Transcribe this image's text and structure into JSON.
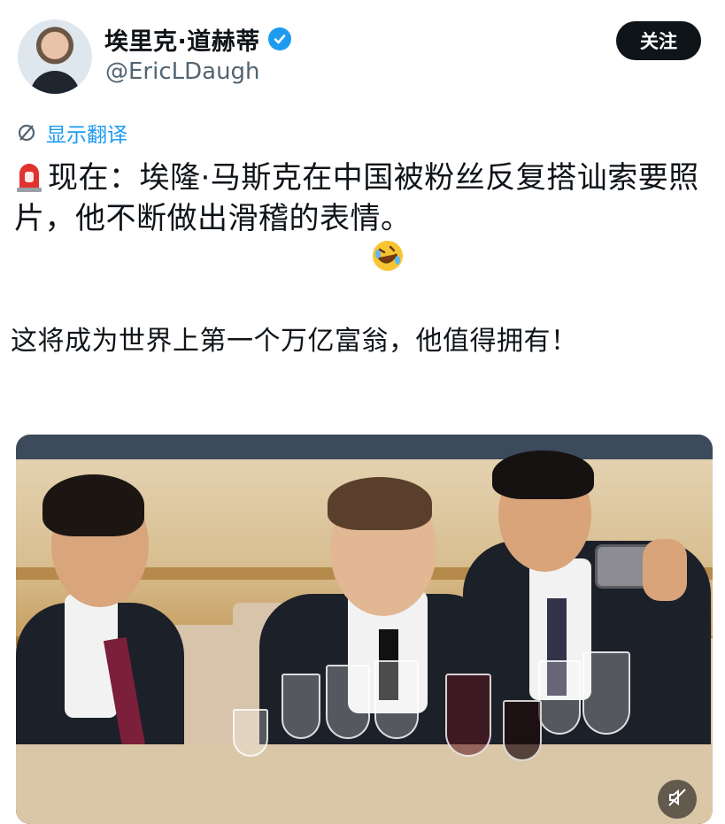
{
  "author": {
    "display_name": "埃里克·道赫蒂",
    "handle": "@EricLDaugh",
    "verified": true,
    "verified_color": "#1d9bf0"
  },
  "follow_button": {
    "label": "关注"
  },
  "translate": {
    "label": "显示翻译",
    "icon": "translate-icon",
    "color": "#1d9bf0"
  },
  "tweet": {
    "line1_emoji": "siren-emoji",
    "line1": "现在：埃隆·马斯克在中国被粉丝反复搭讪索要照片，他不断做出滑稽的表情。",
    "line1_emoji_end": "rolling-laughing-emoji",
    "line2": "这将成为世界上第一个万亿富翁，他值得拥有！"
  },
  "media": {
    "type": "photo",
    "mute_icon": "muted-speaker-icon"
  },
  "colors": {
    "text": "#0f1419",
    "secondary": "#536471",
    "accent": "#1d9bf0"
  }
}
